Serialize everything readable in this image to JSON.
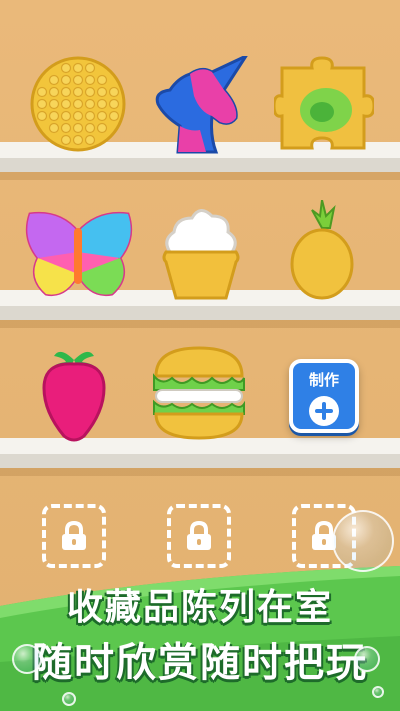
{
  "shelf_items": [
    {
      "name": "round-popit",
      "colors": [
        "#f2c53b"
      ]
    },
    {
      "name": "unicorn-popit",
      "colors": [
        "#2b6be0",
        "#e940a8"
      ]
    },
    {
      "name": "puzzle-popit",
      "colors": [
        "#f0c040",
        "#7fd34a"
      ]
    },
    {
      "name": "butterfly-popit",
      "colors": [
        "#ff5fb0",
        "#45c0f0",
        "#f6e24a"
      ]
    },
    {
      "name": "icecream-popit",
      "colors": [
        "#ffffff",
        "#f2c03c"
      ]
    },
    {
      "name": "pineapple-popit",
      "colors": [
        "#f1c23e",
        "#7bcf3a"
      ]
    },
    {
      "name": "strawberry-popit",
      "colors": [
        "#e91e7b",
        "#2fb84a"
      ]
    },
    {
      "name": "burger-popit",
      "colors": [
        "#f1c23e",
        "#6fd14a"
      ]
    }
  ],
  "make_button": {
    "label": "制作"
  },
  "locked_slots": 3,
  "banner": {
    "line1": "收藏品陈列在室",
    "line2": "随时欣赏随时把玩",
    "color": "#5cc74e"
  }
}
